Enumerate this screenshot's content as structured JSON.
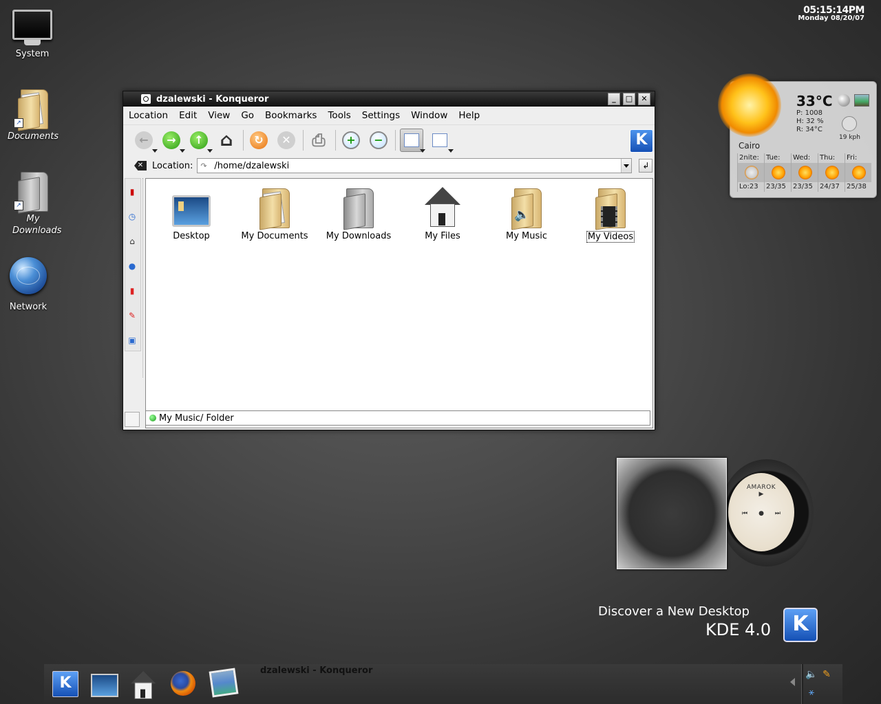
{
  "clock": {
    "time": "05:15:14PM",
    "date": "Monday 08/20/07"
  },
  "desktop_icons": [
    {
      "label": "System"
    },
    {
      "label": "Documents"
    },
    {
      "label": "My Downloads"
    },
    {
      "label": "Network"
    }
  ],
  "window": {
    "title": "dzalewski - Konqueror",
    "menu": [
      "Location",
      "Edit",
      "View",
      "Go",
      "Bookmarks",
      "Tools",
      "Settings",
      "Window",
      "Help"
    ],
    "location_label": "Location:",
    "location_value": "/home/dzalewski",
    "files": [
      {
        "name": "Desktop"
      },
      {
        "name": "My Documents"
      },
      {
        "name": "My Downloads"
      },
      {
        "name": "My Files"
      },
      {
        "name": "My Music"
      },
      {
        "name": "My Videos"
      }
    ],
    "status_text": "My Music/  Folder"
  },
  "weather": {
    "temp": "33°C",
    "pressure": "P:  1008",
    "humidity": "H:  32 %",
    "realfeel": "R:  34°C",
    "wind": "19 kph",
    "city": "Cairo",
    "days": [
      {
        "name": "2nite:",
        "temps": "Lo:23"
      },
      {
        "name": "Tue:",
        "temps": "23/35"
      },
      {
        "name": "Wed:",
        "temps": "23/35"
      },
      {
        "name": "Thu:",
        "temps": "24/37"
      },
      {
        "name": "Fri:",
        "temps": "25/38"
      }
    ]
  },
  "amarok": {
    "title": "AMAROK",
    "play": "▶",
    "prev": "⏮",
    "stop": "●",
    "next": "⏭"
  },
  "promo": {
    "line1": "Discover a New Desktop",
    "line2": "KDE 4.0",
    "logo": "K"
  },
  "taskbar": {
    "active_task": "dzalewski - Konqueror",
    "kmenu": "K"
  },
  "icons": {
    "back": "←",
    "forward": "→",
    "up": "↑",
    "home": "⌂",
    "reload": "↻",
    "stop": "✕",
    "print": "⎙",
    "zoom_in": "+",
    "zoom_out": "−"
  }
}
